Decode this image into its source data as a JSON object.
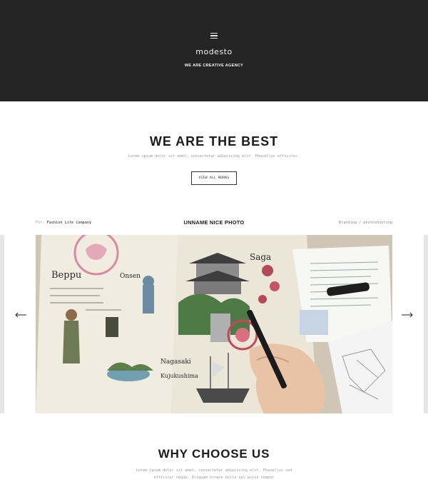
{
  "header": {
    "logo": "modesto",
    "tagline": "WE ARE CREATIVE AGENCY",
    "background": "#242424"
  },
  "intro": {
    "title": "WE ARE THE BEST",
    "text": "Lorem ipsum dolor sit amet, consectetur adipiscing elit. Phasellus efficitur.",
    "button_label": "VIEW ALL WORKS"
  },
  "portfolio": {
    "for_label": "For:",
    "client": "Fashion Life company",
    "title": "UNNAME NICE PHOTO",
    "tags": "Branding / photoshooting",
    "slide_image": "travel-sketchbook-photo",
    "prev_icon": "arrow-left-icon",
    "next_icon": "arrow-right-icon"
  },
  "why": {
    "title": "WHY CHOOSE US",
    "line1": "Lorem ipsum dolor sit amet, consectetur adipiscing elit. Phasellus sed",
    "line2": "efficitur neque. Aliquam ornare nulla vel purus tempor"
  }
}
